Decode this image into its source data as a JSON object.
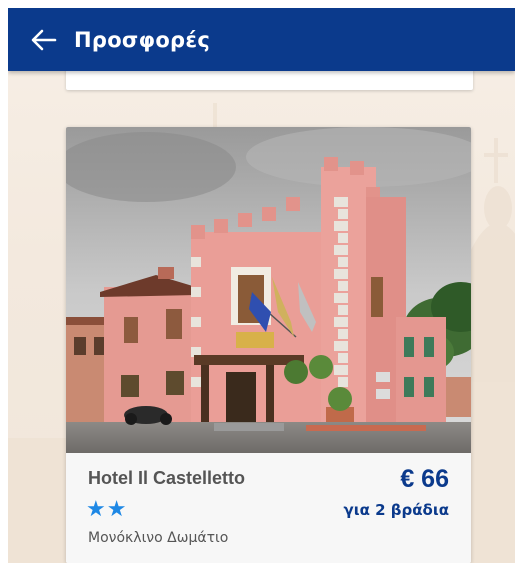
{
  "header": {
    "title": "Προσφορές",
    "back_icon": "arrow-left-icon"
  },
  "offer": {
    "hotel_name": "Hotel Il Castelletto",
    "stars": "★★",
    "star_rating": 2,
    "price": "€ 66",
    "nights": "για 2 βράδια",
    "room_type": "Μονόκλινο Δωμάτιο"
  },
  "colors": {
    "appbar": "#0b3a8c",
    "accent_text": "#0b3a8c",
    "star": "#1e88e5",
    "background": "#f4ebe0"
  }
}
